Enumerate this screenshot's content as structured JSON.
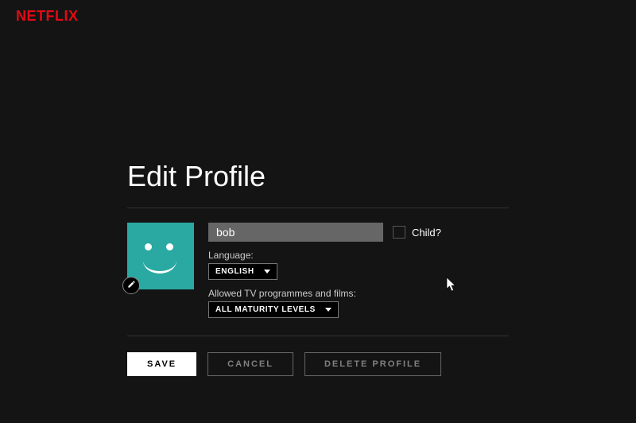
{
  "brand": {
    "logo": "NETFLIX"
  },
  "page": {
    "title": "Edit Profile",
    "name_value": "bob",
    "child_label": "Child?",
    "language_label": "Language:",
    "language_value": "ENGLISH",
    "maturity_label": "Allowed TV programmes and films:",
    "maturity_value": "ALL MATURITY LEVELS",
    "buttons": {
      "save": "SAVE",
      "cancel": "CANCEL",
      "delete": "DELETE PROFILE"
    }
  }
}
